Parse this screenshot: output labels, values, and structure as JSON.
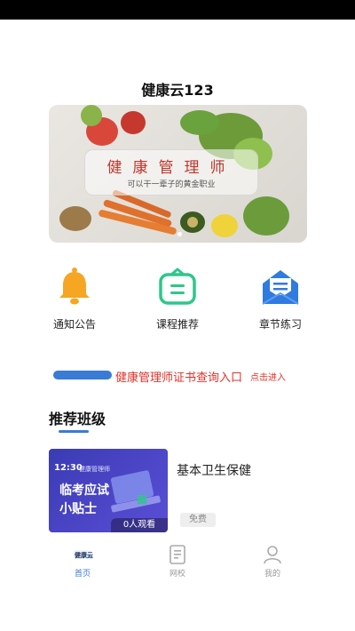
{
  "app": {
    "title": "健康云123"
  },
  "banner": {
    "title": "健康管理师",
    "subtitle": "可以干一辈子的黄金职业"
  },
  "menu": {
    "items": [
      {
        "label": "通知公告",
        "icon": "bell-icon",
        "color": "#f5a623"
      },
      {
        "label": "课程推荐",
        "icon": "course-board-icon",
        "color": "#2dc78a"
      },
      {
        "label": "章节练习",
        "icon": "envelope-icon",
        "color": "#2f7be0"
      }
    ]
  },
  "notice": {
    "text": "健康管理师证书查询入口",
    "link": "点击进入"
  },
  "section": {
    "title": "推荐班级"
  },
  "course": {
    "thumb_time": "12:30",
    "thumb_brand": "健康管理师",
    "thumb_line1": "临考应试",
    "thumb_line2": "小贴士",
    "views": "0人观看",
    "name": "基本卫生保健",
    "badge": "免费"
  },
  "tabbar": {
    "items": [
      {
        "label": "首页",
        "icon": "home-logo-icon",
        "active": true
      },
      {
        "label": "网校",
        "icon": "school-book-icon",
        "active": false
      },
      {
        "label": "我的",
        "icon": "user-icon",
        "active": false
      }
    ]
  },
  "colors": {
    "accent": "#3a7bd5",
    "notice_red": "#e0322a"
  }
}
